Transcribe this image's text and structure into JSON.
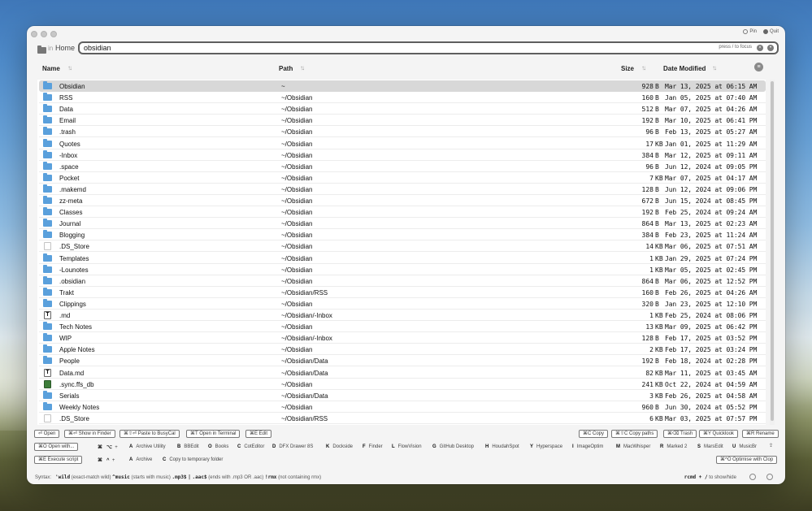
{
  "window": {
    "top_right": [
      {
        "label": "Pin",
        "icon": "pin-icon"
      },
      {
        "label": "Quit",
        "icon": "quit-icon"
      }
    ]
  },
  "search": {
    "scope_in": "in",
    "scope": "Home",
    "value": "obsidian",
    "hint": "press / to focus"
  },
  "columns": {
    "name": "Name",
    "path": "Path",
    "size": "Size",
    "date": "Date Modified"
  },
  "rows": [
    {
      "name": "Obsidian",
      "path": "~",
      "size": "928",
      "unit": "B",
      "date": "Mar 13, 2025 at 06:15 AM",
      "icon": "folder"
    },
    {
      "name": "RSS",
      "path": "~/Obsidian",
      "size": "160",
      "unit": "B",
      "date": "Jan 05, 2025 at 07:40 AM",
      "icon": "folder"
    },
    {
      "name": "Data",
      "path": "~/Obsidian",
      "size": "512",
      "unit": "B",
      "date": "Mar 07, 2025 at 04:26 AM",
      "icon": "folder"
    },
    {
      "name": "Email",
      "path": "~/Obsidian",
      "size": "192",
      "unit": "B",
      "date": "Mar 10, 2025 at 06:41 PM",
      "icon": "folder"
    },
    {
      "name": ".trash",
      "path": "~/Obsidian",
      "size": "96",
      "unit": "B",
      "date": "Feb 13, 2025 at 05:27 AM",
      "icon": "folder"
    },
    {
      "name": "Quotes",
      "path": "~/Obsidian",
      "size": "17",
      "unit": "KB",
      "date": "Jan 01, 2025 at 11:29 AM",
      "icon": "folder"
    },
    {
      "name": "-Inbox",
      "path": "~/Obsidian",
      "size": "384",
      "unit": "B",
      "date": "Mar 12, 2025 at 09:11 AM",
      "icon": "folder"
    },
    {
      "name": ".space",
      "path": "~/Obsidian",
      "size": "96",
      "unit": "B",
      "date": "Jun 12, 2024 at 09:05 PM",
      "icon": "folder"
    },
    {
      "name": "Pocket",
      "path": "~/Obsidian",
      "size": "7",
      "unit": "KB",
      "date": "Mar 07, 2025 at 04:17 AM",
      "icon": "folder"
    },
    {
      "name": ".makemd",
      "path": "~/Obsidian",
      "size": "128",
      "unit": "B",
      "date": "Jun 12, 2024 at 09:06 PM",
      "icon": "folder"
    },
    {
      "name": "zz-meta",
      "path": "~/Obsidian",
      "size": "672",
      "unit": "B",
      "date": "Jun 15, 2024 at 08:45 PM",
      "icon": "folder"
    },
    {
      "name": "Classes",
      "path": "~/Obsidian",
      "size": "192",
      "unit": "B",
      "date": "Feb 25, 2024 at 09:24 AM",
      "icon": "folder"
    },
    {
      "name": "Journal",
      "path": "~/Obsidian",
      "size": "864",
      "unit": "B",
      "date": "Mar 13, 2025 at 02:23 AM",
      "icon": "folder"
    },
    {
      "name": "Blogging",
      "path": "~/Obsidian",
      "size": "384",
      "unit": "B",
      "date": "Feb 23, 2025 at 11:24 AM",
      "icon": "folder"
    },
    {
      "name": ".DS_Store",
      "path": "~/Obsidian",
      "size": "14",
      "unit": "KB",
      "date": "Mar 06, 2025 at 07:51 AM",
      "icon": "doc"
    },
    {
      "name": "Templates",
      "path": "~/Obsidian",
      "size": "1",
      "unit": "KB",
      "date": "Jan 29, 2025 at 07:24 PM",
      "icon": "folder"
    },
    {
      "name": "-Lounotes",
      "path": "~/Obsidian",
      "size": "1",
      "unit": "KB",
      "date": "Mar 05, 2025 at 02:45 PM",
      "icon": "folder"
    },
    {
      "name": ".obsidian",
      "path": "~/Obsidian",
      "size": "864",
      "unit": "B",
      "date": "Mar 06, 2025 at 12:52 PM",
      "icon": "folder"
    },
    {
      "name": "Trakt",
      "path": "~/Obsidian/RSS",
      "size": "160",
      "unit": "B",
      "date": "Feb 26, 2025 at 04:26 AM",
      "icon": "folder"
    },
    {
      "name": "Clippings",
      "path": "~/Obsidian",
      "size": "320",
      "unit": "B",
      "date": "Jan 23, 2025 at 12:10 PM",
      "icon": "folder"
    },
    {
      "name": ".md",
      "path": "~/Obsidian/-Inbox",
      "size": "1",
      "unit": "KB",
      "date": "Feb 25, 2024 at 08:06 PM",
      "icon": "text"
    },
    {
      "name": "Tech Notes",
      "path": "~/Obsidian",
      "size": "13",
      "unit": "KB",
      "date": "Mar 09, 2025 at 06:42 PM",
      "icon": "folder"
    },
    {
      "name": "WIP",
      "path": "~/Obsidian/-Inbox",
      "size": "128",
      "unit": "B",
      "date": "Feb 17, 2025 at 03:52 PM",
      "icon": "folder"
    },
    {
      "name": "Apple Notes",
      "path": "~/Obsidian",
      "size": "2",
      "unit": "KB",
      "date": "Feb 17, 2025 at 03:24 PM",
      "icon": "folder"
    },
    {
      "name": "People",
      "path": "~/Obsidian/Data",
      "size": "192",
      "unit": "B",
      "date": "Feb 18, 2024 at 02:28 PM",
      "icon": "folder"
    },
    {
      "name": "Data.md",
      "path": "~/Obsidian/Data",
      "size": "82",
      "unit": "KB",
      "date": "Mar 11, 2025 at 03:45 AM",
      "icon": "text"
    },
    {
      "name": ".sync.ffs_db",
      "path": "~/Obsidian",
      "size": "241",
      "unit": "KB",
      "date": "Oct 22, 2024 at 04:59 AM",
      "icon": "json"
    },
    {
      "name": "Serials",
      "path": "~/Obsidian/Data",
      "size": "3",
      "unit": "KB",
      "date": "Feb 26, 2025 at 04:58 AM",
      "icon": "folder"
    },
    {
      "name": "Weekly Notes",
      "path": "~/Obsidian",
      "size": "960",
      "unit": "B",
      "date": "Jun 30, 2024 at 05:52 PM",
      "icon": "folder"
    },
    {
      "name": ".DS_Store",
      "path": "~/Obsidian/RSS",
      "size": "6",
      "unit": "KB",
      "date": "Mar 03, 2025 at 07:57 PM",
      "icon": "doc"
    }
  ],
  "actions_left": {
    "open": "⏎ Open",
    "show_in_finder": "⌘⏎ Show in Finder",
    "paste_to_busycal": "⌘⇧⏎ Paste to BusyCal",
    "open_in_terminal": "⌘T Open in Terminal",
    "edit": "⌘E Edit",
    "open_with": "⌘O Open with...",
    "execute_script": "⌘E Execute script"
  },
  "actions_right": {
    "copy": "⌘C Copy",
    "copy_paths": "⌘⇧C Copy paths",
    "trash": "⌘⌫ Trash",
    "quicklook": "⌘Y Quicklook",
    "rename": "⌘R Rename",
    "optimise": "⌘^O Optimise with Clop"
  },
  "modifiers": {
    "row1": {
      "cmd": "⌘",
      "opt": "⌥",
      "plus": "+"
    },
    "row2": {
      "cmd": "⌘",
      "ctrl": "^",
      "plus": "+"
    }
  },
  "open_with_apps": [
    {
      "key": "A",
      "label": "Archive Utility"
    },
    {
      "key": "B",
      "label": "BBEdit"
    },
    {
      "key": "O",
      "label": "Books"
    },
    {
      "key": "C",
      "label": "CotEditor"
    },
    {
      "key": "D",
      "label": "DFX Drawer 8S"
    },
    {
      "key": "K",
      "label": "Dockside"
    },
    {
      "key": "F",
      "label": "Finder"
    },
    {
      "key": "L",
      "label": "FlowVision"
    },
    {
      "key": "G",
      "label": "GitHub Desktop"
    },
    {
      "key": "H",
      "label": "HoudahSpot"
    },
    {
      "key": "Y",
      "label": "Hyperspace"
    },
    {
      "key": "I",
      "label": "ImageOptim"
    },
    {
      "key": "M",
      "label": "MacWhisper"
    },
    {
      "key": "R",
      "label": "Marked 2"
    },
    {
      "key": "S",
      "label": "MarsEdit"
    },
    {
      "key": "U",
      "label": "MusicBr"
    }
  ],
  "extra_actions": [
    {
      "key": "A",
      "label": "Archive"
    },
    {
      "key": "C",
      "label": "Copy to temporary folder"
    }
  ],
  "syntax_bar": {
    "label": "Syntax:",
    "t1": "'wild",
    "d1": "(exact-match wild)",
    "t2": "^music",
    "d2": "(starts with music)",
    "t3": ".mp3$",
    "sep": "|",
    "t4": ".aac$",
    "d4": "(ends with .mp3 OR .aac)",
    "t5": "!rmx",
    "d5": "(not containing rmx)",
    "hint_code": "rcmd + /",
    "hint_text": "to show/hide"
  }
}
